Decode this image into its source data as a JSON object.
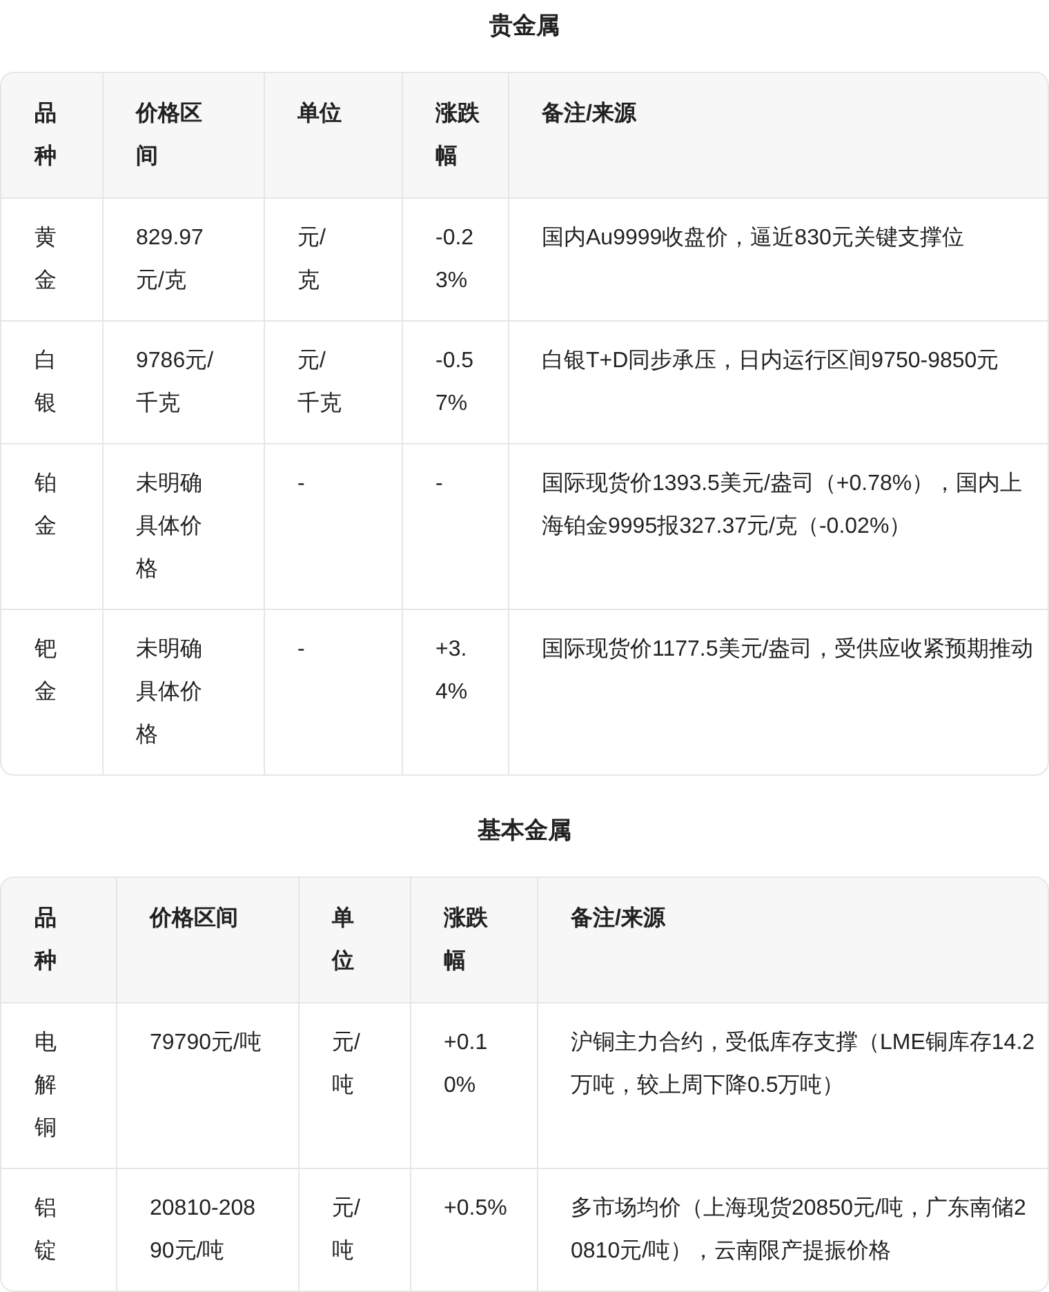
{
  "sections": [
    {
      "title": "贵金属",
      "columns": [
        "品种",
        "价格区间",
        "单位",
        "涨跌幅",
        "备注/来源"
      ],
      "rows": [
        [
          "黄金",
          "829.97元/克",
          "元/克",
          "-0.23%",
          "国内Au9999收盘价，逼近830元关键支撑位"
        ],
        [
          "白银",
          "9786元/千克",
          "元/千克",
          "-0.57%",
          "白银T+D同步承压，日内运行区间9750-9850元"
        ],
        [
          "铂金",
          "未明确具体价格",
          "-",
          "-",
          "国际现货价1393.5美元/盎司（+0.78%），国内上海铂金9995报327.37元/克（-0.02%）"
        ],
        [
          "钯金",
          "未明确具体价格",
          "-",
          "+3.4%",
          "国际现货价1177.5美元/盎司，受供应收紧预期推动"
        ]
      ]
    },
    {
      "title": "基本金属",
      "columns": [
        "品种",
        "价格区间",
        "单位",
        "涨跌幅",
        "备注/来源"
      ],
      "rows": [
        [
          "电解铜",
          "79790元/吨",
          "元/吨",
          "+0.10%",
          "沪铜主力合约，受低库存支撑（LME铜库存14.2万吨，较上周下降0.5万吨）"
        ],
        [
          "铝锭",
          "20810-20890元/吨",
          "元/吨",
          "+0.5%",
          "多市场均价（上海现货20850元/吨，广东南储20810元/吨），云南限产提振价格"
        ]
      ]
    }
  ]
}
